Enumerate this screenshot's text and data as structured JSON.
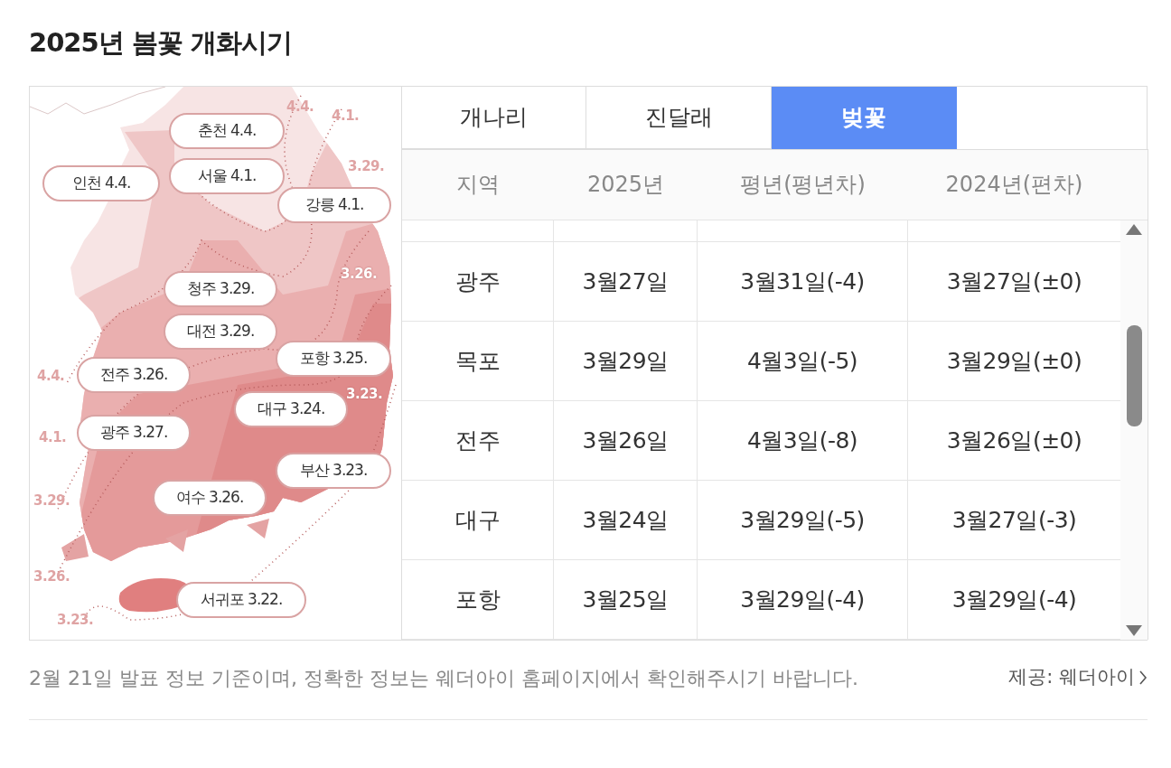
{
  "title": "2025년 봄꽃 개화시기",
  "map": {
    "city_labels": [
      {
        "text": "춘천 4.4."
      },
      {
        "text": "인천 4.4."
      },
      {
        "text": "서울 4.1."
      },
      {
        "text": "강릉 4.1."
      },
      {
        "text": "청주 3.29."
      },
      {
        "text": "대전 3.29."
      },
      {
        "text": "포항 3.25."
      },
      {
        "text": "전주 3.26."
      },
      {
        "text": "대구 3.24."
      },
      {
        "text": "광주 3.27."
      },
      {
        "text": "부산 3.23."
      },
      {
        "text": "여수 3.26."
      },
      {
        "text": "서귀포 3.22."
      }
    ],
    "contour_labels": [
      {
        "text": "4.4.",
        "kind": "outside"
      },
      {
        "text": "4.1.",
        "kind": "outside"
      },
      {
        "text": "3.29.",
        "kind": "outside"
      },
      {
        "text": "3.26.",
        "kind": "inside"
      },
      {
        "text": "3.23.",
        "kind": "inside"
      },
      {
        "text": "4.4.",
        "kind": "outside"
      },
      {
        "text": "4.1.",
        "kind": "outside"
      },
      {
        "text": "3.29.",
        "kind": "outside"
      },
      {
        "text": "3.26.",
        "kind": "outside"
      },
      {
        "text": "3.23.",
        "kind": "outside"
      }
    ]
  },
  "tabs": [
    {
      "label": "개나리",
      "selected": false
    },
    {
      "label": "진달래",
      "selected": false
    },
    {
      "label": "벚꽃",
      "selected": true
    }
  ],
  "table": {
    "columns": [
      "지역",
      "2025년",
      "평년(평년차)",
      "2024년(편차)"
    ],
    "rows": [
      [
        "광주",
        "3월27일",
        "3월31일(-4)",
        "3월27일(±0)"
      ],
      [
        "목포",
        "3월29일",
        "4월3일(-5)",
        "3월29일(±0)"
      ],
      [
        "전주",
        "3월26일",
        "4월3일(-8)",
        "3월26일(±0)"
      ],
      [
        "대구",
        "3월24일",
        "3월29일(-5)",
        "3월27일(-3)"
      ],
      [
        "포항",
        "3월25일",
        "3월29일(-4)",
        "3월29일(-4)"
      ]
    ]
  },
  "footer": {
    "note": "2월 21일 발표 정보 기준이며, 정확한 정보는 웨더아이 홈페이지에서 확인해주시기 바랍니다.",
    "source_link": "제공: 웨더아이"
  }
}
